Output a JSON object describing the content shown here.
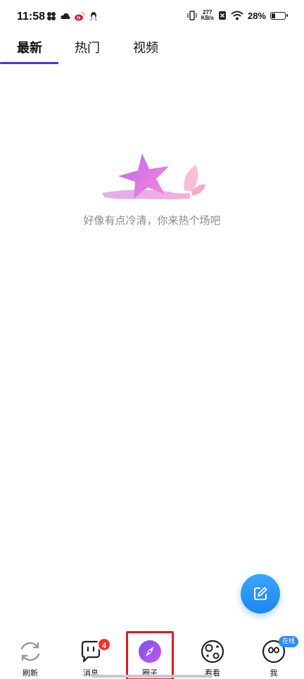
{
  "status_bar": {
    "time": "11:58",
    "net_speed_value": "277",
    "net_speed_unit": "KB/s",
    "battery_percent": "28%",
    "battery_level": 0.28,
    "icons_left": [
      "fan-icon",
      "cloud-icon",
      "weibo-icon",
      "qq-penguin-icon"
    ],
    "icons_right": [
      "vibrate-icon",
      "no-sim-icon",
      "wifi-icon",
      "battery-icon"
    ]
  },
  "tabs": [
    {
      "label": "最新",
      "active": true
    },
    {
      "label": "热门",
      "active": false
    },
    {
      "label": "视频",
      "active": false
    }
  ],
  "empty_state": {
    "message": "好像有点冷清，你来热个场吧"
  },
  "fab": {
    "icon": "compose-icon",
    "color": "#2f8cf0"
  },
  "bottom_nav": [
    {
      "label": "刷新",
      "icon": "refresh-icon"
    },
    {
      "label": "消息",
      "icon": "message-icon",
      "badge": "4"
    },
    {
      "label": "圈子",
      "icon": "compass-icon",
      "selected": true
    },
    {
      "label": "看看",
      "icon": "planet-icon"
    },
    {
      "label": "我",
      "icon": "profile-icon",
      "badge": "在线"
    }
  ],
  "colors": {
    "accent": "#5b2fd9",
    "badge_red": "#ff2d2d",
    "online_blue": "#2f8cf0",
    "highlight_red": "#e0181f"
  }
}
